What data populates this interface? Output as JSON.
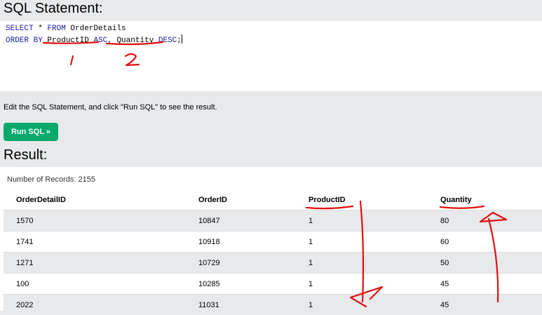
{
  "sql_panel": {
    "heading": "SQL Statement:",
    "line1_kw1": "SELECT",
    "line1_rest": " * ",
    "line1_kw2": "FROM",
    "line1_table": " OrderDetails",
    "line2_kw1": "ORDER BY",
    "line2_col1": " ProductID ",
    "line2_kw2": "ASC",
    "line2_sep": ", ",
    "line2_col2": "Quantity ",
    "line2_kw3": "DESC",
    "line2_end": ";"
  },
  "instructions": "Edit the SQL Statement, and click \"Run SQL\" to see the result.",
  "run_button": {
    "label": "Run SQL »"
  },
  "result": {
    "heading": "Result:",
    "record_count": "Number of Records: 2155",
    "columns": [
      "OrderDetailID",
      "OrderID",
      "ProductID",
      "Quantity"
    ],
    "rows": [
      [
        "1570",
        "10847",
        "1",
        "80"
      ],
      [
        "1741",
        "10918",
        "1",
        "60"
      ],
      [
        "1271",
        "10729",
        "1",
        "50"
      ],
      [
        "100",
        "10285",
        "1",
        "45"
      ],
      [
        "2022",
        "11031",
        "1",
        "45"
      ]
    ]
  },
  "annotations": {
    "mark_1": "1",
    "mark_2": "2",
    "color": "#e01010"
  },
  "colors": {
    "accent": "#04aa6d",
    "keyword": "#1a1aa6",
    "page_bg": "#e7e9eb"
  }
}
